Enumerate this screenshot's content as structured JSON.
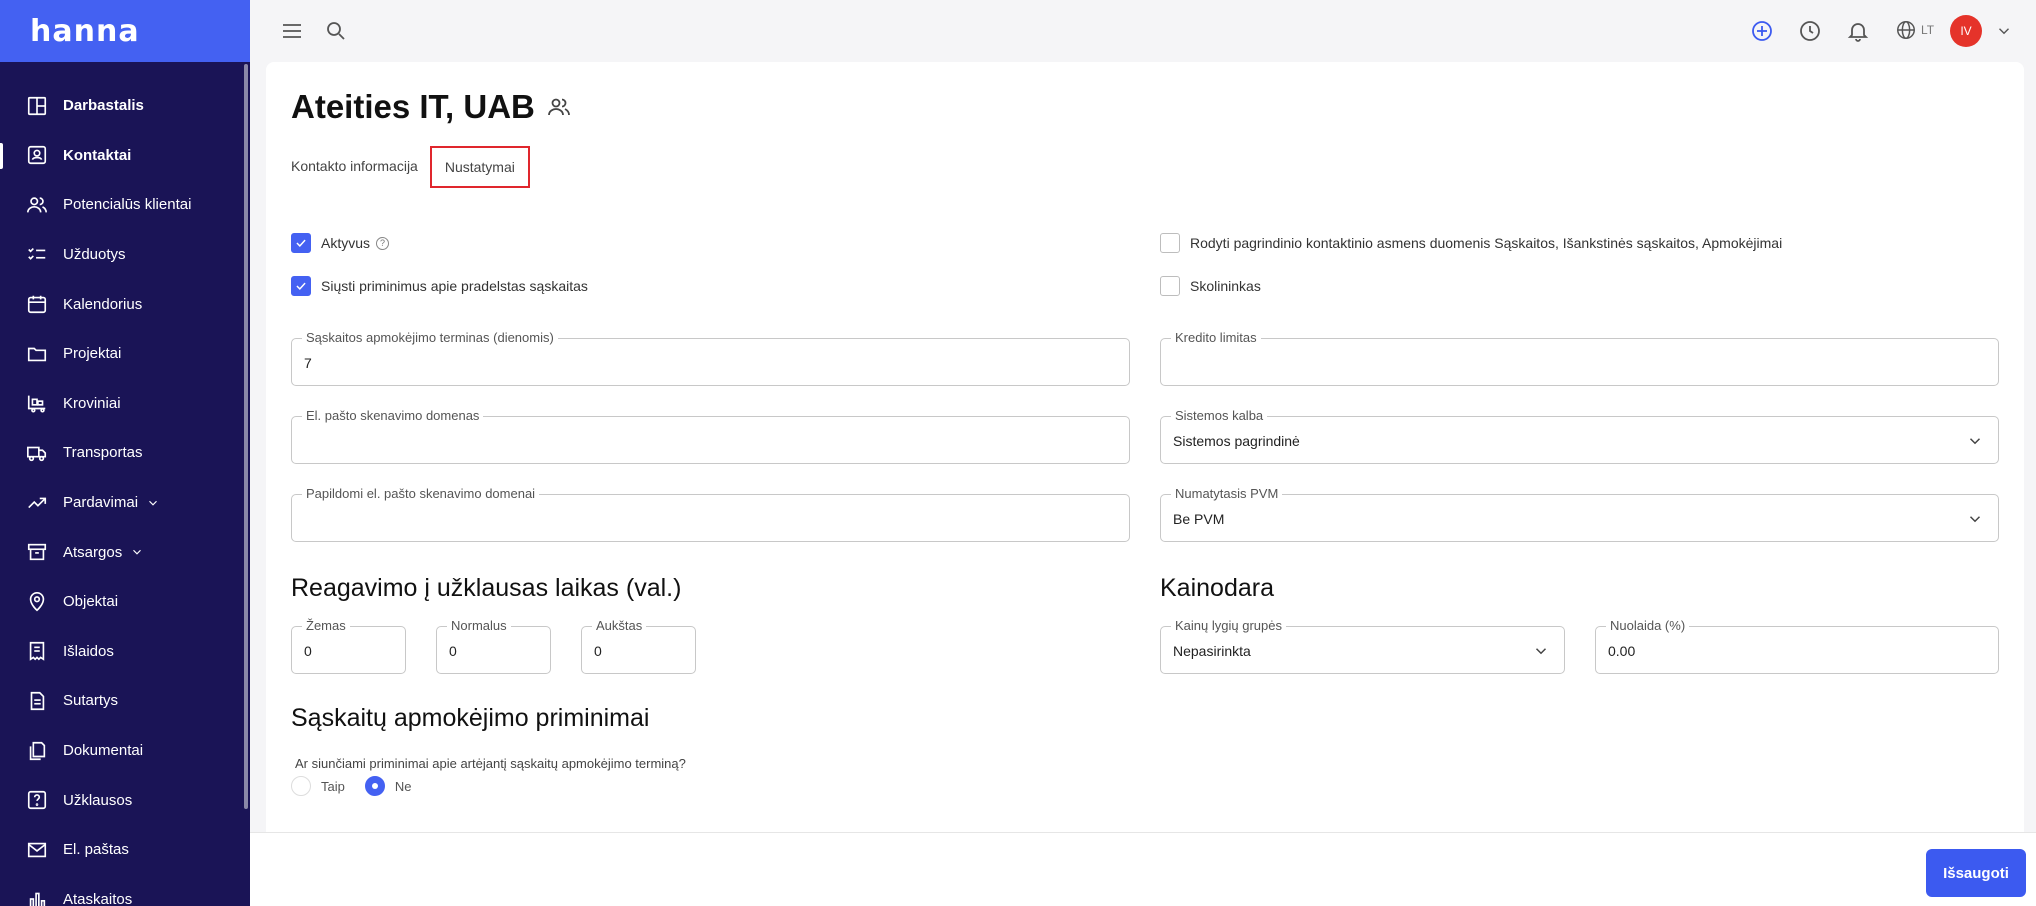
{
  "app": {
    "logo": "hanna"
  },
  "sidebar": {
    "items": [
      {
        "label": "Darbastalis",
        "icon": "dashboard-icon"
      },
      {
        "label": "Kontaktai",
        "icon": "contact-card-icon"
      },
      {
        "label": "Potencialūs klientai",
        "icon": "users-icon"
      },
      {
        "label": "Užduotys",
        "icon": "checklist-icon"
      },
      {
        "label": "Kalendorius",
        "icon": "calendar-icon"
      },
      {
        "label": "Projektai",
        "icon": "folder-icon"
      },
      {
        "label": "Kroviniai",
        "icon": "cart-icon"
      },
      {
        "label": "Transportas",
        "icon": "truck-icon"
      },
      {
        "label": "Pardavimai",
        "icon": "trend-icon"
      },
      {
        "label": "Atsargos",
        "icon": "archive-icon"
      },
      {
        "label": "Objektai",
        "icon": "location-icon"
      },
      {
        "label": "Išlaidos",
        "icon": "receipt-icon"
      },
      {
        "label": "Sutartys",
        "icon": "contract-icon"
      },
      {
        "label": "Dokumentai",
        "icon": "documents-icon"
      },
      {
        "label": "Užklausos",
        "icon": "question-icon"
      },
      {
        "label": "El. paštas",
        "icon": "mail-icon"
      },
      {
        "label": "Ataskaitos",
        "icon": "bar-chart-icon"
      }
    ]
  },
  "topbar": {
    "lang": "LT",
    "avatar": "IV"
  },
  "page": {
    "title": "Ateities IT, UAB",
    "tabs": [
      "Kontakto informacija",
      "Nustatymai"
    ]
  },
  "settings": {
    "active_label": "Aktyvus",
    "active_help": "?",
    "reminders_label": "Siųsti priminimus apie pradelstas sąskaitas",
    "show_primary_label": "Rodyti pagrindinio kontaktinio asmens duomenis Sąskaitos, Išankstinės sąskaitos, Apmokėjimai",
    "debtor_label": "Skolininkas",
    "payment_term": {
      "label": "Sąskaitos apmokėjimo terminas (dienomis)",
      "value": "7"
    },
    "credit_limit": {
      "label": "Kredito limitas",
      "value": ""
    },
    "email_domain": {
      "label": "El. pašto skenavimo domenas",
      "value": ""
    },
    "system_lang": {
      "label": "Sistemos kalba",
      "value": "Sistemos pagrindinė"
    },
    "extra_domains": {
      "label": "Papildomi el. pašto skenavimo domenai",
      "value": ""
    },
    "default_vat": {
      "label": "Numatytasis PVM",
      "value": "Be PVM"
    }
  },
  "response_time": {
    "title": "Reagavimo į užklausas laikas (val.)",
    "low": {
      "label": "Žemas",
      "value": "0"
    },
    "normal": {
      "label": "Normalus",
      "value": "0"
    },
    "high": {
      "label": "Aukštas",
      "value": "0"
    }
  },
  "pricing": {
    "title": "Kainodara",
    "price_group": {
      "label": "Kainų lygių grupės",
      "value": "Nepasirinkta"
    },
    "discount": {
      "label": "Nuolaida (%)",
      "value": "0.00"
    }
  },
  "payment_reminders": {
    "title": "Sąskaitų apmokėjimo priminimai",
    "question": "Ar siunčiami priminimai apie artėjantį sąskaitų apmokėjimo terminą?",
    "yes": "Taip",
    "no": "Ne"
  },
  "footer": {
    "save": "Išsaugoti"
  }
}
